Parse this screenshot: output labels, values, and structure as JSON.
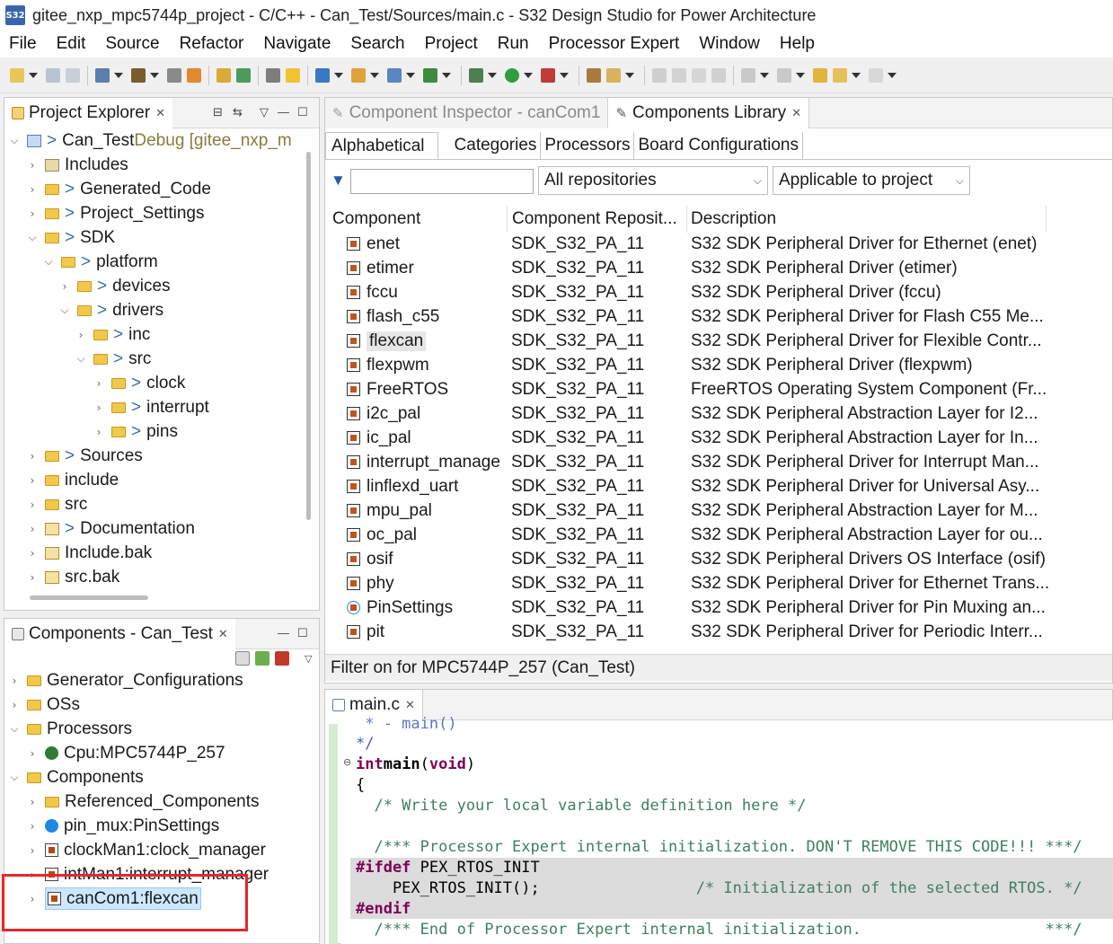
{
  "window": {
    "title": "gitee_nxp_mpc5744p_project - C/C++ - Can_Test/Sources/main.c - S32 Design Studio for Power Architecture",
    "logo_text": "S32"
  },
  "menu": [
    "File",
    "Edit",
    "Source",
    "Refactor",
    "Navigate",
    "Search",
    "Project",
    "Run",
    "Processor Expert",
    "Window",
    "Help"
  ],
  "project_explorer": {
    "title": "Project Explorer",
    "items": [
      {
        "label": "Can_Test",
        "suffix": " Debug [gitee_nxp_m",
        "prefix": "> "
      },
      {
        "label": "Includes"
      },
      {
        "label": "Generated_Code",
        "prefix": "> "
      },
      {
        "label": "Project_Settings",
        "prefix": "> "
      },
      {
        "label": "SDK",
        "prefix": "> "
      },
      {
        "label": "platform",
        "prefix": "> "
      },
      {
        "label": "devices",
        "prefix": "> "
      },
      {
        "label": "drivers",
        "prefix": "> "
      },
      {
        "label": "inc",
        "prefix": "> "
      },
      {
        "label": "src",
        "prefix": "> "
      },
      {
        "label": "clock",
        "prefix": "> "
      },
      {
        "label": "interrupt",
        "prefix": "> "
      },
      {
        "label": "pins",
        "prefix": "> "
      },
      {
        "label": "Sources",
        "prefix": "> "
      },
      {
        "label": "include"
      },
      {
        "label": "src"
      },
      {
        "label": "Documentation",
        "prefix": "> "
      },
      {
        "label": "Include.bak"
      },
      {
        "label": "src.bak"
      }
    ]
  },
  "components_view": {
    "title": "Components - Can_Test",
    "items": [
      {
        "label": "Generator_Configurations"
      },
      {
        "label": "OSs"
      },
      {
        "label": "Processors"
      },
      {
        "label": "Cpu:MPC5744P_257"
      },
      {
        "label": "Components"
      },
      {
        "label": "Referenced_Components"
      },
      {
        "label": "pin_mux:PinSettings"
      },
      {
        "label": "clockMan1:clock_manager"
      },
      {
        "label": "intMan1:interrupt_manager"
      },
      {
        "label": "canCom1:flexcan"
      }
    ]
  },
  "library": {
    "tab_inspector": "Component Inspector - canCom1",
    "tab_library": "Components Library",
    "subtabs": [
      "Alphabetical",
      "Categories",
      "Processors",
      "Board Configurations"
    ],
    "filter_value": "",
    "repo_select": "All repositories",
    "scope_select": "Applicable to project",
    "columns": [
      "Component",
      "Component Reposit...",
      "Description"
    ],
    "rows": [
      {
        "name": "enet",
        "repo": "SDK_S32_PA_11",
        "desc": "S32 SDK Peripheral Driver for Ethernet (enet)"
      },
      {
        "name": "etimer",
        "repo": "SDK_S32_PA_11",
        "desc": "S32 SDK Peripheral Driver (etimer)"
      },
      {
        "name": "fccu",
        "repo": "SDK_S32_PA_11",
        "desc": "S32 SDK Peripheral Driver (fccu)"
      },
      {
        "name": "flash_c55",
        "repo": "SDK_S32_PA_11",
        "desc": "S32 SDK Peripheral Driver for Flash C55 Me..."
      },
      {
        "name": "flexcan",
        "repo": "SDK_S32_PA_11",
        "desc": "S32 SDK Peripheral Driver for Flexible Contr..."
      },
      {
        "name": "flexpwm",
        "repo": "SDK_S32_PA_11",
        "desc": "S32 SDK Peripheral Driver (flexpwm)"
      },
      {
        "name": "FreeRTOS",
        "repo": "SDK_S32_PA_11",
        "desc": "FreeRTOS Operating System Component (Fr..."
      },
      {
        "name": "i2c_pal",
        "repo": "SDK_S32_PA_11",
        "desc": "S32 SDK Peripheral Abstraction Layer for I2..."
      },
      {
        "name": "ic_pal",
        "repo": "SDK_S32_PA_11",
        "desc": "S32 SDK Peripheral Abstraction Layer for In..."
      },
      {
        "name": "interrupt_manage",
        "repo": "SDK_S32_PA_11",
        "desc": "S32 SDK Peripheral Driver for Interrupt Man..."
      },
      {
        "name": "linflexd_uart",
        "repo": "SDK_S32_PA_11",
        "desc": "S32 SDK Peripheral Driver for Universal Asy..."
      },
      {
        "name": "mpu_pal",
        "repo": "SDK_S32_PA_11",
        "desc": "S32 SDK Peripheral Abstraction Layer for M..."
      },
      {
        "name": "oc_pal",
        "repo": "SDK_S32_PA_11",
        "desc": "S32 SDK Peripheral Abstraction Layer for ou..."
      },
      {
        "name": "osif",
        "repo": "SDK_S32_PA_11",
        "desc": "S32 SDK Peripheral Drivers OS Interface (osif)"
      },
      {
        "name": "phy",
        "repo": "SDK_S32_PA_11",
        "desc": "S32 SDK Peripheral Driver for Ethernet Trans..."
      },
      {
        "name": "PinSettings",
        "repo": "SDK_S32_PA_11",
        "desc": "S32 SDK Peripheral Driver for Pin Muxing an..."
      },
      {
        "name": "pit",
        "repo": "SDK_S32_PA_11",
        "desc": "S32 SDK Peripheral Driver for Periodic Interr..."
      }
    ],
    "status": "Filter on for MPC5744P_257 (Can_Test)"
  },
  "editor": {
    "tab": "main.c",
    "lines": [
      " * - main()",
      "*/",
      "int main(void)",
      "{",
      "  /* Write your local variable definition here */",
      "",
      "  /*** Processor Expert internal initialization. DON'T REMOVE THIS CODE!!! ***/",
      "  #ifdef PEX_RTOS_INIT",
      "    PEX_RTOS_INIT();                 /* Initialization of the selected RTOS. */",
      "  #endif",
      "  /*** End of Processor Expert internal initialization.                    ***/"
    ]
  },
  "colors": {
    "highlight_box": "#e8262a",
    "selection": "#cce8ff",
    "keyword": "#7f0055",
    "comment": "#3f7f5f"
  }
}
